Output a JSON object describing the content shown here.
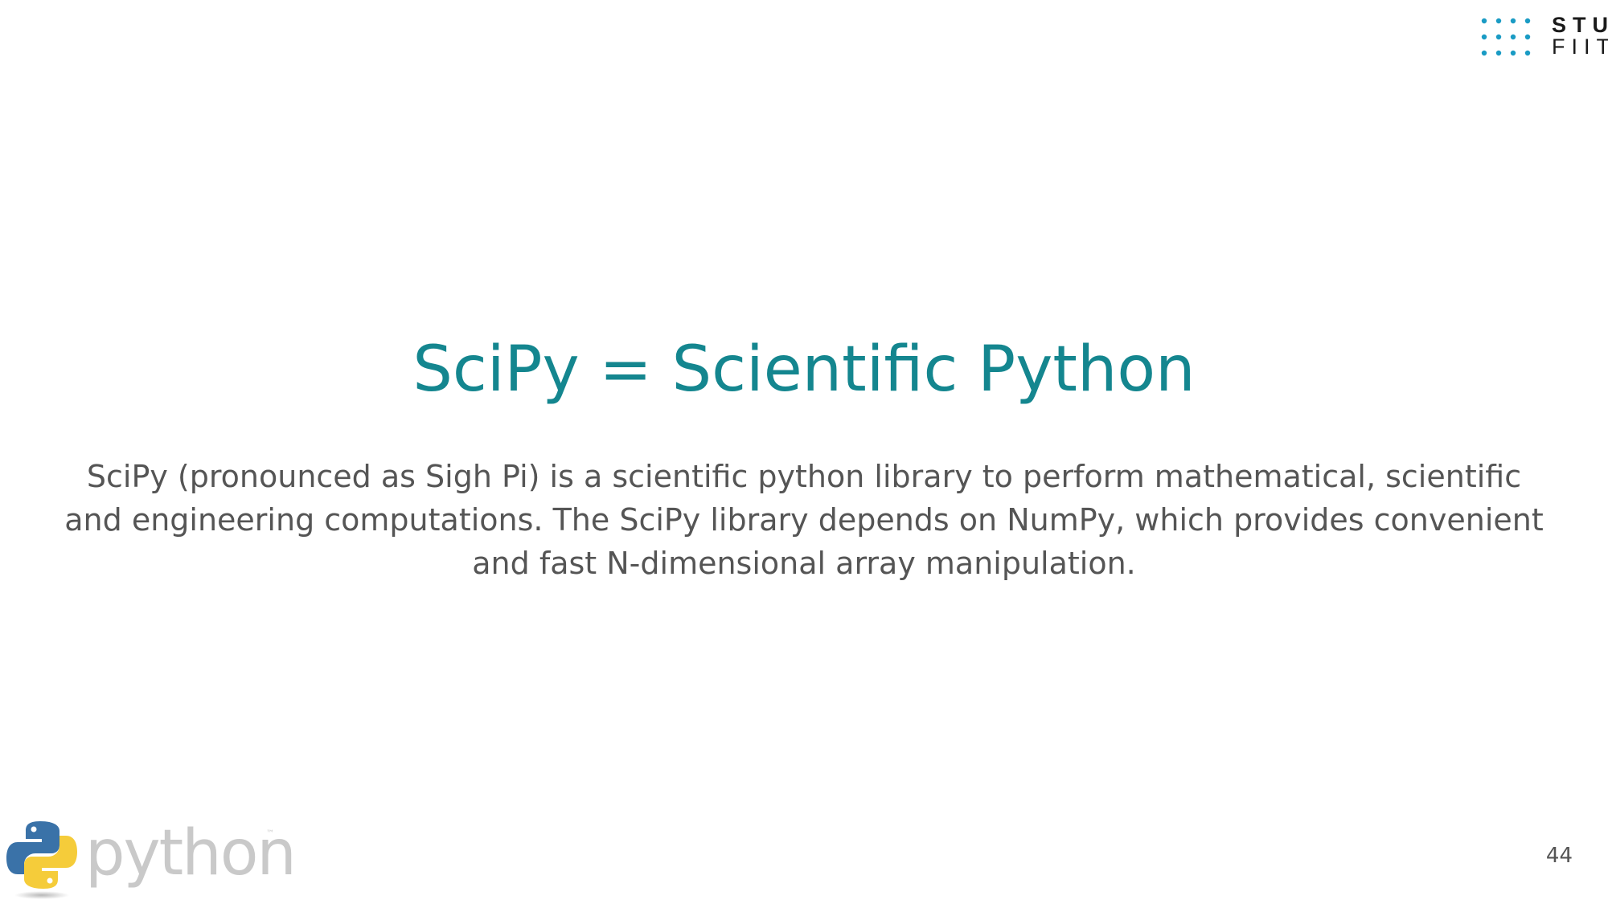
{
  "logo": {
    "line1": "STU",
    "line2": "FIIT",
    "dot_color": "#1a9bc4",
    "icon": "stu-fiit-logo-icon"
  },
  "slide": {
    "title": "SciPy = Scientific Python",
    "body": "SciPy (pronounced as Sigh Pi) is a scientific python library to perform mathematical, scientific and engineering computations. The SciPy library depends on NumPy, which provides convenient and fast N-dimensional array manipulation.",
    "page_number": "44"
  },
  "python_logo": {
    "word": "python",
    "trademark": "™",
    "icon": "python-logo-icon"
  },
  "colors": {
    "title": "#14868f",
    "body": "#555555",
    "background": "#ffffff"
  }
}
